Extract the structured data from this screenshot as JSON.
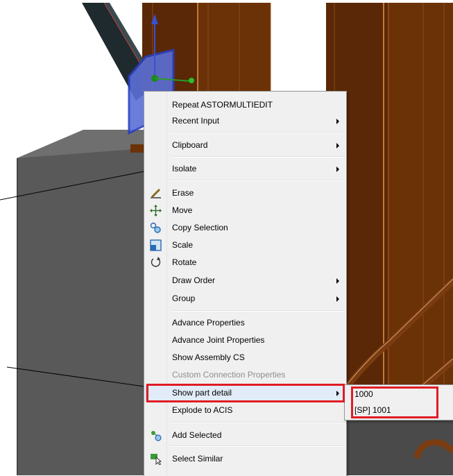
{
  "context_menu": {
    "items": [
      {
        "label": "Repeat ASTORMULTIEDIT",
        "has_submenu": false
      },
      {
        "label": "Recent Input",
        "has_submenu": true
      },
      {
        "label": "Clipboard",
        "has_submenu": true
      },
      {
        "label": "Isolate",
        "has_submenu": true
      },
      {
        "label": "Erase",
        "icon": "eraser-brush-icon"
      },
      {
        "label": "Move",
        "icon": "move-arrows-icon"
      },
      {
        "label": "Copy Selection",
        "icon": "copy-selection-icon"
      },
      {
        "label": "Scale",
        "icon": "scale-icon"
      },
      {
        "label": "Rotate",
        "icon": "rotate-icon"
      },
      {
        "label": "Draw Order",
        "has_submenu": true
      },
      {
        "label": "Group",
        "has_submenu": true
      },
      {
        "label": "Advance Properties"
      },
      {
        "label": "Advance Joint Properties"
      },
      {
        "label": "Show Assembly CS"
      },
      {
        "label": "Custom Connection Properties",
        "disabled": true
      },
      {
        "label": "Show part detail",
        "has_submenu": true,
        "highlighted": true
      },
      {
        "label": "Explode to ACIS"
      },
      {
        "label": "Add Selected",
        "icon": "add-selected-icon"
      },
      {
        "label": "Select Similar",
        "icon": "select-similar-icon"
      }
    ]
  },
  "submenu": {
    "items": [
      {
        "label": "1000"
      },
      {
        "label": "[SP] 1001"
      }
    ]
  },
  "colors": {
    "highlight_box": "#e01b24",
    "menu_bg": "#f0f0f0",
    "beam_brown": "#6b3208",
    "slab_grey": "#5a5a5a"
  }
}
